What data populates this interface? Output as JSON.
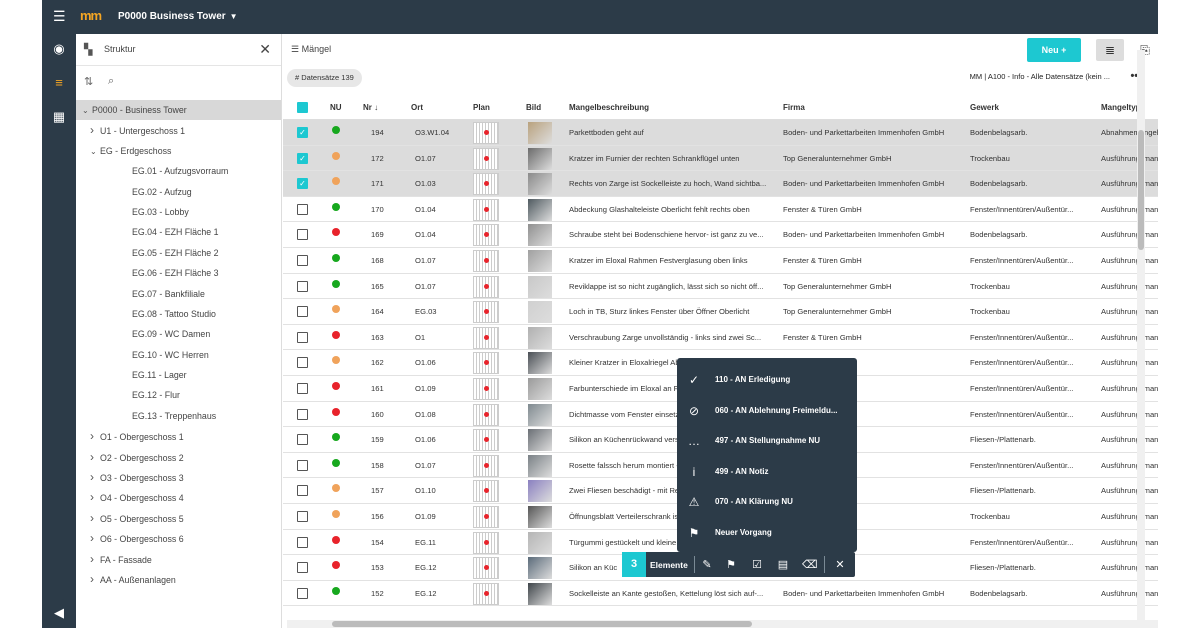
{
  "app": {
    "logo": "mm",
    "project": "P0000 Business Tower"
  },
  "sidebar": {
    "title": "Struktur",
    "tree": [
      {
        "label": "P0000 - Business Tower",
        "level": 0,
        "arrow": "v",
        "selected": true
      },
      {
        "label": "U1 - Untergeschoss 1",
        "level": 1,
        "arrow": ">"
      },
      {
        "label": "EG - Erdgeschoss",
        "level": 1,
        "arrow": "v"
      },
      {
        "label": "EG.01 - Aufzugsvorraum",
        "level": 2,
        "arrow": ""
      },
      {
        "label": "EG.02 - Aufzug",
        "level": 2,
        "arrow": ""
      },
      {
        "label": "EG.03 - Lobby",
        "level": 2,
        "arrow": ""
      },
      {
        "label": "EG.04 - EZH Fläche 1",
        "level": 2,
        "arrow": ""
      },
      {
        "label": "EG.05 - EZH Fläche 2",
        "level": 2,
        "arrow": ""
      },
      {
        "label": "EG.06 - EZH Fläche 3",
        "level": 2,
        "arrow": ""
      },
      {
        "label": "EG.07 - Bankfiliale",
        "level": 2,
        "arrow": ""
      },
      {
        "label": "EG.08 - Tattoo Studio",
        "level": 2,
        "arrow": ""
      },
      {
        "label": "EG.09 - WC Damen",
        "level": 2,
        "arrow": ""
      },
      {
        "label": "EG.10 - WC Herren",
        "level": 2,
        "arrow": ""
      },
      {
        "label": "EG.11 - Lager",
        "level": 2,
        "arrow": ""
      },
      {
        "label": "EG.12 - Flur",
        "level": 2,
        "arrow": ""
      },
      {
        "label": "EG.13 - Treppenhaus",
        "level": 2,
        "arrow": ""
      },
      {
        "label": "O1 - Obergeschoss 1",
        "level": 1,
        "arrow": ">"
      },
      {
        "label": "O2 - Obergeschoss 2",
        "level": 1,
        "arrow": ">"
      },
      {
        "label": "O3 - Obergeschoss 3",
        "level": 1,
        "arrow": ">"
      },
      {
        "label": "O4 - Obergeschoss 4",
        "level": 1,
        "arrow": ">"
      },
      {
        "label": "O5 - Obergeschoss 5",
        "level": 1,
        "arrow": ">"
      },
      {
        "label": "O6 - Obergeschoss 6",
        "level": 1,
        "arrow": ">"
      },
      {
        "label": "FA - Fassade",
        "level": 1,
        "arrow": ">"
      },
      {
        "label": "AA - Außenanlagen",
        "level": 1,
        "arrow": ">"
      }
    ]
  },
  "main": {
    "title": "Mängel",
    "new_label": "Neu +",
    "count_label": "# Datensätze 139",
    "filter_label": "MM | A100 - Info - Alle Datensätze (kein ...",
    "more_label": "•••",
    "columns": [
      "NU",
      "Nr ↓",
      "Ort",
      "Plan",
      "Bild",
      "Mangelbeschreibung",
      "Firma",
      "Gewerk",
      "Mangeltyp"
    ]
  },
  "colors": {
    "green": "#17a81e",
    "orange": "#f0a35b",
    "red": "#e8232b",
    "accent": "#1dc8d1"
  },
  "rows": [
    {
      "sel": true,
      "nu": "green",
      "nr": "194",
      "ort": "O3.W1.04",
      "desc": "Parkettboden geht auf",
      "firma": "Boden- und Parkettarbeiten Immenhofen GmbH",
      "gewerk": "Bodenbelagsarb.",
      "typ": "Abnahmemangel"
    },
    {
      "sel": true,
      "nu": "orange",
      "nr": "172",
      "ort": "O1.07",
      "desc": "Kratzer im Furnier der rechten Schrankflügel unten",
      "firma": "Top Generalunternehmer GmbH",
      "gewerk": "Trockenbau",
      "typ": "Ausführungsmangel"
    },
    {
      "sel": true,
      "nu": "orange",
      "nr": "171",
      "ort": "O1.03",
      "desc": "Rechts von Zarge ist Sockelleiste zu hoch, Wand sichtba...",
      "firma": "Boden- und Parkettarbeiten Immenhofen GmbH",
      "gewerk": "Bodenbelagsarb.",
      "typ": "Ausführungsmangel"
    },
    {
      "sel": false,
      "nu": "green",
      "nr": "170",
      "ort": "O1.04",
      "desc": "Abdeckung Glashalteleiste Oberlicht fehlt rechts oben",
      "firma": "Fenster & Türen GmbH",
      "gewerk": "Fenster/Innentüren/Außentür...",
      "typ": "Ausführungsmangel"
    },
    {
      "sel": false,
      "nu": "red",
      "nr": "169",
      "ort": "O1.04",
      "desc": "Schraube steht bei Bodenschiene hervor- ist ganz zu ve...",
      "firma": "Boden- und Parkettarbeiten Immenhofen GmbH",
      "gewerk": "Bodenbelagsarb.",
      "typ": "Ausführungsmangel"
    },
    {
      "sel": false,
      "nu": "green",
      "nr": "168",
      "ort": "O1.07",
      "desc": "Kratzer im Eloxal Rahmen Festverglasung oben links",
      "firma": "Fenster & Türen GmbH",
      "gewerk": "Fenster/Innentüren/Außentür...",
      "typ": "Ausführungsmangel"
    },
    {
      "sel": false,
      "nu": "green",
      "nr": "165",
      "ort": "O1.07",
      "desc": "Reviklappe ist so nicht zugänglich, lässt sich so nicht öff...",
      "firma": "Top Generalunternehmer GmbH",
      "gewerk": "Trockenbau",
      "typ": "Ausführungsmangel"
    },
    {
      "sel": false,
      "nu": "orange",
      "nr": "164",
      "ort": "EG.03",
      "desc": "Loch in TB, Sturz linkes Fenster über Öffner Oberlicht",
      "firma": "Top Generalunternehmer GmbH",
      "gewerk": "Trockenbau",
      "typ": "Ausführungsmangel"
    },
    {
      "sel": false,
      "nu": "red",
      "nr": "163",
      "ort": "O1",
      "desc": "Verschraubung Zarge unvollständig - links sind zwei Sc...",
      "firma": "Fenster & Türen GmbH",
      "gewerk": "Fenster/Innentüren/Außentür...",
      "typ": "Ausführungsmangel"
    },
    {
      "sel": false,
      "nu": "orange",
      "nr": "162",
      "ort": "O1.06",
      "desc": "Kleiner Kratzer in Eloxalriegel Absturzsicheru",
      "firma": "",
      "gewerk": "Fenster/Innentüren/Außentür...",
      "typ": "Ausführungsmangel"
    },
    {
      "sel": false,
      "nu": "red",
      "nr": "161",
      "ort": "O1.09",
      "desc": "Farbunterschiede im Eloxal an Fußleiste un",
      "firma": "",
      "gewerk": "Fenster/Innentüren/Außentür...",
      "typ": "Ausführungsmangel"
    },
    {
      "sel": false,
      "nu": "red",
      "nr": "160",
      "ort": "O1.08",
      "desc": "Dichtmasse vom Fenster einsetzen außen u",
      "firma": "",
      "gewerk": "Fenster/Innentüren/Außentür...",
      "typ": "Ausführungsmangel"
    },
    {
      "sel": false,
      "nu": "green",
      "nr": "159",
      "ort": "O1.06",
      "desc": "Silikon an Küchenrückwand verschmiert - n",
      "firma": "",
      "gewerk": "Fliesen-/Plattenarb.",
      "typ": "Ausführungsmangel"
    },
    {
      "sel": false,
      "nu": "green",
      "nr": "158",
      "ort": "O1.07",
      "desc": "Rosette falssch herum montiert - drehen",
      "firma": "",
      "gewerk": "Fenster/Innentüren/Außentür...",
      "typ": "Ausführungsmangel"
    },
    {
      "sel": false,
      "nu": "orange",
      "nr": "157",
      "ort": "O1.10",
      "desc": "Zwei Fliesen beschädigt - mit Reparaturspa",
      "firma": "",
      "gewerk": "Fliesen-/Plattenarb.",
      "typ": "Ausführungsmangel"
    },
    {
      "sel": false,
      "nu": "orange",
      "nr": "156",
      "ort": "O1.09",
      "desc": "Öffnungsblatt Verteilerschrank ist verzoger",
      "firma": "",
      "gewerk": "Trockenbau",
      "typ": "Ausführungsmangel"
    },
    {
      "sel": false,
      "nu": "red",
      "nr": "154",
      "ort": "EG.11",
      "desc": "Türgummi gestückelt und kleine Macken L",
      "firma": "",
      "gewerk": "Fenster/Innentüren/Außentür...",
      "typ": "Ausführungsmangel"
    },
    {
      "sel": false,
      "nu": "red",
      "nr": "153",
      "ort": "EG.12",
      "desc": "Silikon an Küc",
      "firma": "& Co. KG",
      "gewerk": "Fliesen-/Plattenarb.",
      "typ": "Ausführungsmangel"
    },
    {
      "sel": false,
      "nu": "green",
      "nr": "152",
      "ort": "EG.12",
      "desc": "Sockelleiste an Kante gestoßen, Kettelung löst sich auf-...",
      "firma": "Boden- und Parkettarbeiten Immenhofen GmbH",
      "gewerk": "Bodenbelagsarb.",
      "typ": "Ausführungsmangel"
    }
  ],
  "context_menu": [
    {
      "icon": "check-circle-icon",
      "glyph": "✓",
      "label": "110 - AN Erledigung"
    },
    {
      "icon": "block-icon",
      "glyph": "⊘",
      "label": "060 - AN Ablehnung Freimeldu..."
    },
    {
      "icon": "comment-icon",
      "glyph": "…",
      "label": "497 - AN Stellungnahme NU"
    },
    {
      "icon": "info-icon",
      "glyph": "i",
      "label": "499 - AN Notiz"
    },
    {
      "icon": "warning-icon",
      "glyph": "⚠",
      "label": "070 - AN Klärung NU"
    },
    {
      "icon": "flag-icon",
      "glyph": "⚑",
      "label": "Neuer Vorgang"
    }
  ],
  "action_bar": {
    "count": "3",
    "label": "Elemente"
  }
}
